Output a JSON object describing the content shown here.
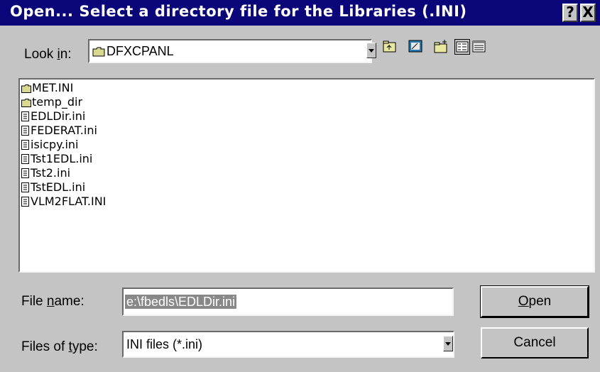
{
  "window": {
    "title": "Open... Select a directory file for the Libraries (.INI)",
    "help_glyph": "?",
    "close_glyph": "X"
  },
  "look_in": {
    "label_prefix": "Look ",
    "label_underlined": "i",
    "label_suffix": "n:",
    "value": "DFXCPANL"
  },
  "toolbar": {
    "icons": [
      "up-one-level-icon",
      "desktop-icon",
      "new-folder-icon",
      "list-view-icon",
      "details-view-icon"
    ]
  },
  "files": [
    {
      "name": "MET.INI",
      "type": "folder"
    },
    {
      "name": "temp_dir",
      "type": "folder"
    },
    {
      "name": "EDLDir.ini",
      "type": "file"
    },
    {
      "name": "FEDERAT.ini",
      "type": "file"
    },
    {
      "name": "isicpy.ini",
      "type": "file"
    },
    {
      "name": "Tst1EDL.ini",
      "type": "file"
    },
    {
      "name": "Tst2.ini",
      "type": "file"
    },
    {
      "name": "TstEDL.ini",
      "type": "file"
    },
    {
      "name": "VLM2FLAT.INI",
      "type": "file"
    }
  ],
  "file_name": {
    "label_prefix": "File ",
    "label_underlined": "n",
    "label_suffix": "ame:",
    "value": "e:\\fbedls\\EDLDir.ini"
  },
  "files_of_type": {
    "label_prefix": "Files of ",
    "label_underlined": "t",
    "label_suffix": "ype:",
    "value": "INI files (*.ini)"
  },
  "buttons": {
    "open_underlined": "O",
    "open_rest": "pen",
    "cancel": "Cancel"
  },
  "colors": {
    "titlebar": "#0a067a",
    "face": "#c4c4c4",
    "selection": "#888888"
  }
}
